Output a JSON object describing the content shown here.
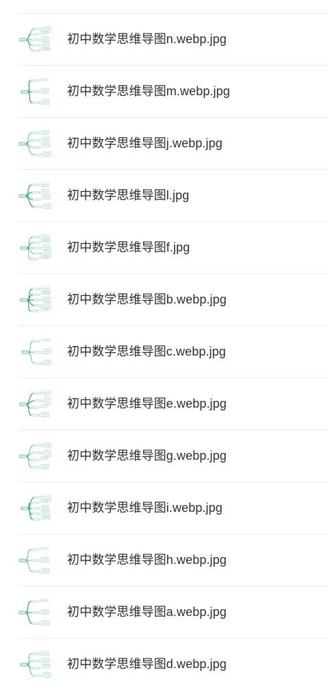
{
  "files": [
    {
      "name": "初中数学思维导图n.webp.jpg",
      "icon": "mindmap-thumbnail-icon"
    },
    {
      "name": "初中数学思维导图m.webp.jpg",
      "icon": "mindmap-thumbnail-icon"
    },
    {
      "name": "初中数学思维导图j.webp.jpg",
      "icon": "mindmap-thumbnail-icon"
    },
    {
      "name": "初中数学思维导图l.jpg",
      "icon": "mindmap-thumbnail-icon"
    },
    {
      "name": "初中数学思维导图f.jpg",
      "icon": "mindmap-thumbnail-icon"
    },
    {
      "name": "初中数学思维导图b.webp.jpg",
      "icon": "mindmap-thumbnail-icon"
    },
    {
      "name": "初中数学思维导图c.webp.jpg",
      "icon": "mindmap-thumbnail-icon"
    },
    {
      "name": "初中数学思维导图e.webp.jpg",
      "icon": "mindmap-thumbnail-icon"
    },
    {
      "name": "初中数学思维导图g.webp.jpg",
      "icon": "mindmap-thumbnail-icon"
    },
    {
      "name": "初中数学思维导图i.webp.jpg",
      "icon": "mindmap-thumbnail-icon"
    },
    {
      "name": "初中数学思维导图h.webp.jpg",
      "icon": "mindmap-thumbnail-icon"
    },
    {
      "name": "初中数学思维导图a.webp.jpg",
      "icon": "mindmap-thumbnail-icon"
    },
    {
      "name": "初中数学思维导图d.webp.jpg",
      "icon": "mindmap-thumbnail-icon"
    }
  ],
  "colors": {
    "accent": "#2e9a86",
    "text": "#2b2d3a",
    "divider": "#ececee"
  }
}
